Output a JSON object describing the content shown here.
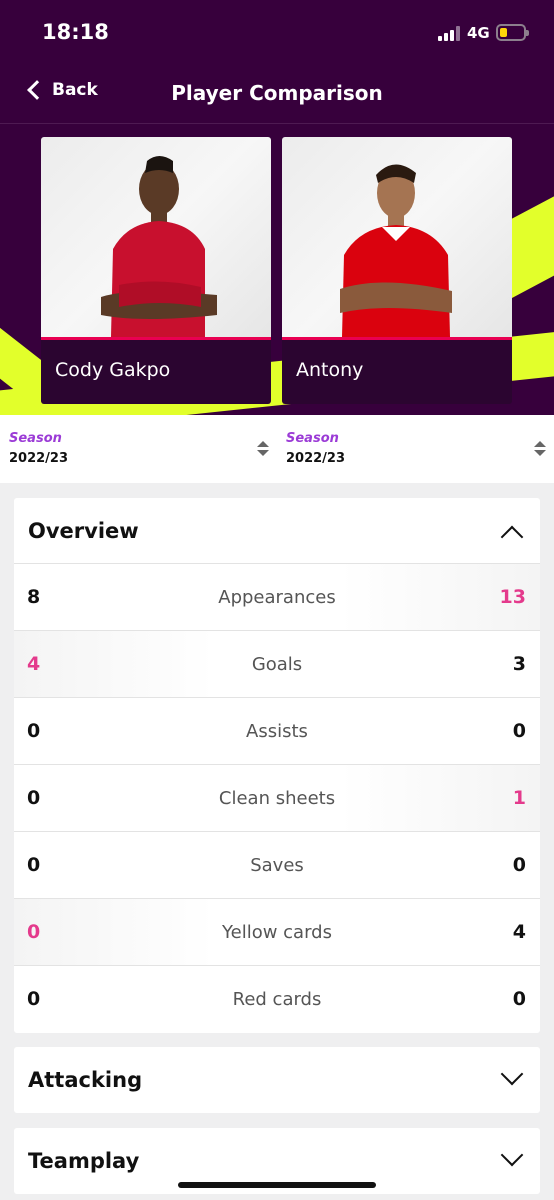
{
  "status_bar": {
    "time": "18:18",
    "network": "4G"
  },
  "nav": {
    "back_label": "Back",
    "title": "Player Comparison"
  },
  "players": [
    {
      "name": "Cody Gakpo",
      "kit_color": "#c8102e"
    },
    {
      "name": "Antony",
      "kit_color": "#da020e"
    }
  ],
  "seasons": [
    {
      "label": "Season",
      "value": "2022/23"
    },
    {
      "label": "Season",
      "value": "2022/23"
    }
  ],
  "overview": {
    "title": "Overview",
    "rows": [
      {
        "stat": "Appearances",
        "left": "8",
        "right": "13",
        "winner": "right"
      },
      {
        "stat": "Goals",
        "left": "4",
        "right": "3",
        "winner": "left"
      },
      {
        "stat": "Assists",
        "left": "0",
        "right": "0",
        "winner": "none"
      },
      {
        "stat": "Clean sheets",
        "left": "0",
        "right": "1",
        "winner": "right"
      },
      {
        "stat": "Saves",
        "left": "0",
        "right": "0",
        "winner": "none"
      },
      {
        "stat": "Yellow cards",
        "left": "0",
        "right": "4",
        "winner": "left"
      },
      {
        "stat": "Red cards",
        "left": "0",
        "right": "0",
        "winner": "none"
      }
    ]
  },
  "sections": {
    "attacking": "Attacking",
    "teamplay": "Teamplay"
  },
  "colors": {
    "header_bg": "#37003c",
    "accent_yellow": "#e2ff2b",
    "accent_pink": "#e90052",
    "winner_text": "#e43a8c",
    "season_label": "#9b3bd6"
  }
}
